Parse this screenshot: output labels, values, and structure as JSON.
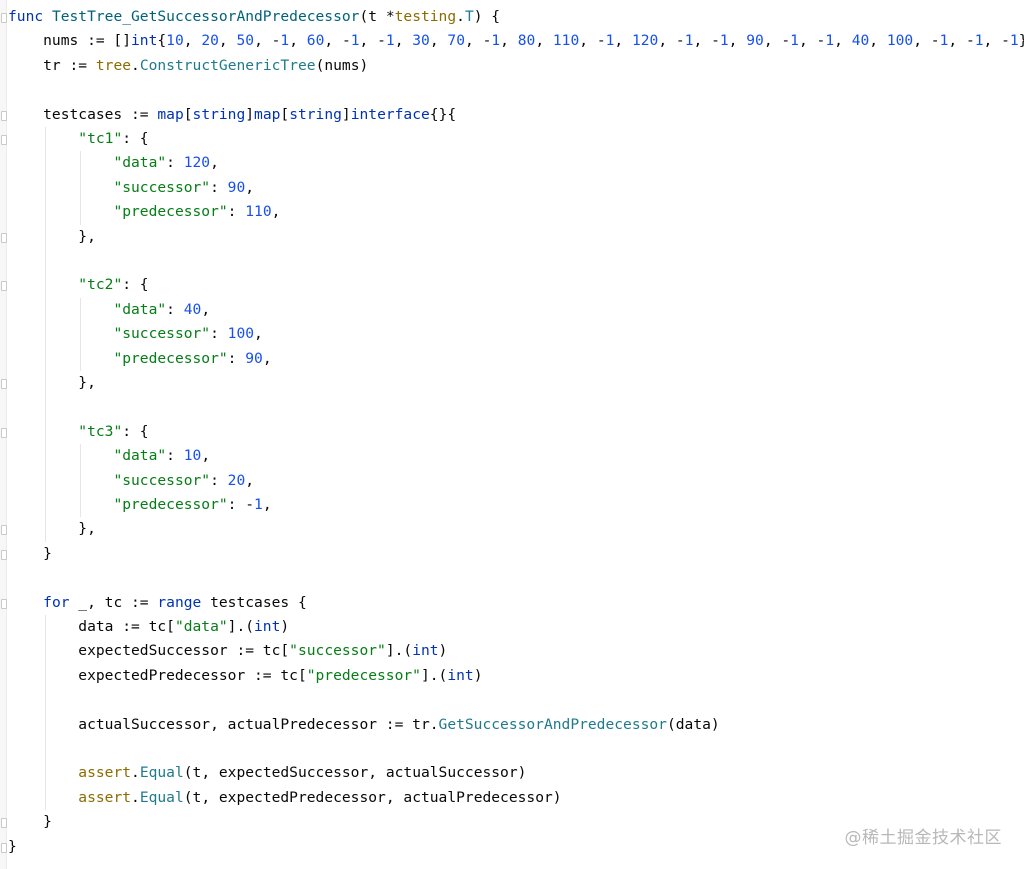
{
  "editor": {
    "lines": [
      [
        {
          "t": "kw",
          "v": "func "
        },
        {
          "t": "fn",
          "v": "TestTree_GetSuccessorAndPredecessor"
        },
        {
          "t": "pl",
          "v": "(t *"
        },
        {
          "t": "pkg",
          "v": "testing"
        },
        {
          "t": "pl",
          "v": "."
        },
        {
          "t": "call",
          "v": "T"
        },
        {
          "t": "pl",
          "v": ") {"
        }
      ],
      [
        {
          "t": "pl",
          "v": "    nums := []"
        },
        {
          "t": "type",
          "v": "int"
        },
        {
          "t": "pl",
          "v": "{"
        },
        {
          "t": "num",
          "v": "10"
        },
        {
          "t": "pl",
          "v": ", "
        },
        {
          "t": "num",
          "v": "20"
        },
        {
          "t": "pl",
          "v": ", "
        },
        {
          "t": "num",
          "v": "50"
        },
        {
          "t": "pl",
          "v": ", -"
        },
        {
          "t": "num",
          "v": "1"
        },
        {
          "t": "pl",
          "v": ", "
        },
        {
          "t": "num",
          "v": "60"
        },
        {
          "t": "pl",
          "v": ", -"
        },
        {
          "t": "num",
          "v": "1"
        },
        {
          "t": "pl",
          "v": ", -"
        },
        {
          "t": "num",
          "v": "1"
        },
        {
          "t": "pl",
          "v": ", "
        },
        {
          "t": "num",
          "v": "30"
        },
        {
          "t": "pl",
          "v": ", "
        },
        {
          "t": "num",
          "v": "70"
        },
        {
          "t": "pl",
          "v": ", -"
        },
        {
          "t": "num",
          "v": "1"
        },
        {
          "t": "pl",
          "v": ", "
        },
        {
          "t": "num",
          "v": "80"
        },
        {
          "t": "pl",
          "v": ", "
        },
        {
          "t": "num",
          "v": "110"
        },
        {
          "t": "pl",
          "v": ", -"
        },
        {
          "t": "num",
          "v": "1"
        },
        {
          "t": "pl",
          "v": ", "
        },
        {
          "t": "num",
          "v": "120"
        },
        {
          "t": "pl",
          "v": ", -"
        },
        {
          "t": "num",
          "v": "1"
        },
        {
          "t": "pl",
          "v": ", -"
        },
        {
          "t": "num",
          "v": "1"
        },
        {
          "t": "pl",
          "v": ", "
        },
        {
          "t": "num",
          "v": "90"
        },
        {
          "t": "pl",
          "v": ", -"
        },
        {
          "t": "num",
          "v": "1"
        },
        {
          "t": "pl",
          "v": ", -"
        },
        {
          "t": "num",
          "v": "1"
        },
        {
          "t": "pl",
          "v": ", "
        },
        {
          "t": "num",
          "v": "40"
        },
        {
          "t": "pl",
          "v": ", "
        },
        {
          "t": "num",
          "v": "100"
        },
        {
          "t": "pl",
          "v": ", -"
        },
        {
          "t": "num",
          "v": "1"
        },
        {
          "t": "pl",
          "v": ", -"
        },
        {
          "t": "num",
          "v": "1"
        },
        {
          "t": "pl",
          "v": ", -"
        },
        {
          "t": "num",
          "v": "1"
        },
        {
          "t": "pl",
          "v": "}"
        }
      ],
      [
        {
          "t": "pl",
          "v": "    tr := "
        },
        {
          "t": "pkg",
          "v": "tree"
        },
        {
          "t": "pl",
          "v": "."
        },
        {
          "t": "call",
          "v": "ConstructGenericTree"
        },
        {
          "t": "pl",
          "v": "(nums)"
        }
      ],
      [],
      [
        {
          "t": "pl",
          "v": "    testcases := "
        },
        {
          "t": "kw",
          "v": "map"
        },
        {
          "t": "pl",
          "v": "["
        },
        {
          "t": "type",
          "v": "string"
        },
        {
          "t": "pl",
          "v": "]"
        },
        {
          "t": "kw",
          "v": "map"
        },
        {
          "t": "pl",
          "v": "["
        },
        {
          "t": "type",
          "v": "string"
        },
        {
          "t": "pl",
          "v": "]"
        },
        {
          "t": "kw",
          "v": "interface"
        },
        {
          "t": "pl",
          "v": "{}{"
        }
      ],
      [
        {
          "t": "pl",
          "v": "        "
        },
        {
          "t": "str",
          "v": "\"tc1\""
        },
        {
          "t": "pl",
          "v": ": {"
        }
      ],
      [
        {
          "t": "pl",
          "v": "            "
        },
        {
          "t": "str",
          "v": "\"data\""
        },
        {
          "t": "pl",
          "v": ": "
        },
        {
          "t": "num",
          "v": "120"
        },
        {
          "t": "pl",
          "v": ","
        }
      ],
      [
        {
          "t": "pl",
          "v": "            "
        },
        {
          "t": "str",
          "v": "\"successor\""
        },
        {
          "t": "pl",
          "v": ": "
        },
        {
          "t": "num",
          "v": "90"
        },
        {
          "t": "pl",
          "v": ","
        }
      ],
      [
        {
          "t": "pl",
          "v": "            "
        },
        {
          "t": "str",
          "v": "\"predecessor\""
        },
        {
          "t": "pl",
          "v": ": "
        },
        {
          "t": "num",
          "v": "110"
        },
        {
          "t": "pl",
          "v": ","
        }
      ],
      [
        {
          "t": "pl",
          "v": "        },"
        }
      ],
      [],
      [
        {
          "t": "pl",
          "v": "        "
        },
        {
          "t": "str",
          "v": "\"tc2\""
        },
        {
          "t": "pl",
          "v": ": {"
        }
      ],
      [
        {
          "t": "pl",
          "v": "            "
        },
        {
          "t": "str",
          "v": "\"data\""
        },
        {
          "t": "pl",
          "v": ": "
        },
        {
          "t": "num",
          "v": "40"
        },
        {
          "t": "pl",
          "v": ","
        }
      ],
      [
        {
          "t": "pl",
          "v": "            "
        },
        {
          "t": "str",
          "v": "\"successor\""
        },
        {
          "t": "pl",
          "v": ": "
        },
        {
          "t": "num",
          "v": "100"
        },
        {
          "t": "pl",
          "v": ","
        }
      ],
      [
        {
          "t": "pl",
          "v": "            "
        },
        {
          "t": "str",
          "v": "\"predecessor\""
        },
        {
          "t": "pl",
          "v": ": "
        },
        {
          "t": "num",
          "v": "90"
        },
        {
          "t": "pl",
          "v": ","
        }
      ],
      [
        {
          "t": "pl",
          "v": "        },"
        }
      ],
      [],
      [
        {
          "t": "pl",
          "v": "        "
        },
        {
          "t": "str",
          "v": "\"tc3\""
        },
        {
          "t": "pl",
          "v": ": {"
        }
      ],
      [
        {
          "t": "pl",
          "v": "            "
        },
        {
          "t": "str",
          "v": "\"data\""
        },
        {
          "t": "pl",
          "v": ": "
        },
        {
          "t": "num",
          "v": "10"
        },
        {
          "t": "pl",
          "v": ","
        }
      ],
      [
        {
          "t": "pl",
          "v": "            "
        },
        {
          "t": "str",
          "v": "\"successor\""
        },
        {
          "t": "pl",
          "v": ": "
        },
        {
          "t": "num",
          "v": "20"
        },
        {
          "t": "pl",
          "v": ","
        }
      ],
      [
        {
          "t": "pl",
          "v": "            "
        },
        {
          "t": "str",
          "v": "\"predecessor\""
        },
        {
          "t": "pl",
          "v": ": -"
        },
        {
          "t": "num",
          "v": "1"
        },
        {
          "t": "pl",
          "v": ","
        }
      ],
      [
        {
          "t": "pl",
          "v": "        },"
        }
      ],
      [
        {
          "t": "pl",
          "v": "    }"
        }
      ],
      [],
      [
        {
          "t": "pl",
          "v": "    "
        },
        {
          "t": "kw",
          "v": "for"
        },
        {
          "t": "pl",
          "v": " _, tc := "
        },
        {
          "t": "kw",
          "v": "range"
        },
        {
          "t": "pl",
          "v": " testcases {"
        }
      ],
      [
        {
          "t": "pl",
          "v": "        data := tc["
        },
        {
          "t": "str",
          "v": "\"data\""
        },
        {
          "t": "pl",
          "v": "].("
        },
        {
          "t": "type",
          "v": "int"
        },
        {
          "t": "pl",
          "v": ")"
        }
      ],
      [
        {
          "t": "pl",
          "v": "        expectedSuccessor := tc["
        },
        {
          "t": "str",
          "v": "\"successor\""
        },
        {
          "t": "pl",
          "v": "].("
        },
        {
          "t": "type",
          "v": "int"
        },
        {
          "t": "pl",
          "v": ")"
        }
      ],
      [
        {
          "t": "pl",
          "v": "        expectedPredecessor := tc["
        },
        {
          "t": "str",
          "v": "\"predecessor\""
        },
        {
          "t": "pl",
          "v": "].("
        },
        {
          "t": "type",
          "v": "int"
        },
        {
          "t": "pl",
          "v": ")"
        }
      ],
      [],
      [
        {
          "t": "pl",
          "v": "        actualSuccessor, actualPredecessor := tr."
        },
        {
          "t": "call",
          "v": "GetSuccessorAndPredecessor"
        },
        {
          "t": "pl",
          "v": "(data)"
        }
      ],
      [],
      [
        {
          "t": "pl",
          "v": "        "
        },
        {
          "t": "pkg",
          "v": "assert"
        },
        {
          "t": "pl",
          "v": "."
        },
        {
          "t": "call",
          "v": "Equal"
        },
        {
          "t": "pl",
          "v": "(t, expectedSuccessor, actualSuccessor)"
        }
      ],
      [
        {
          "t": "pl",
          "v": "        "
        },
        {
          "t": "pkg",
          "v": "assert"
        },
        {
          "t": "pl",
          "v": "."
        },
        {
          "t": "call",
          "v": "Equal"
        },
        {
          "t": "pl",
          "v": "(t, expectedPredecessor, actualPredecessor)"
        }
      ],
      [
        {
          "t": "pl",
          "v": "    }"
        }
      ],
      [
        {
          "t": "pl",
          "v": "}"
        }
      ]
    ]
  },
  "watermark": "@稀土掘金技术社区"
}
